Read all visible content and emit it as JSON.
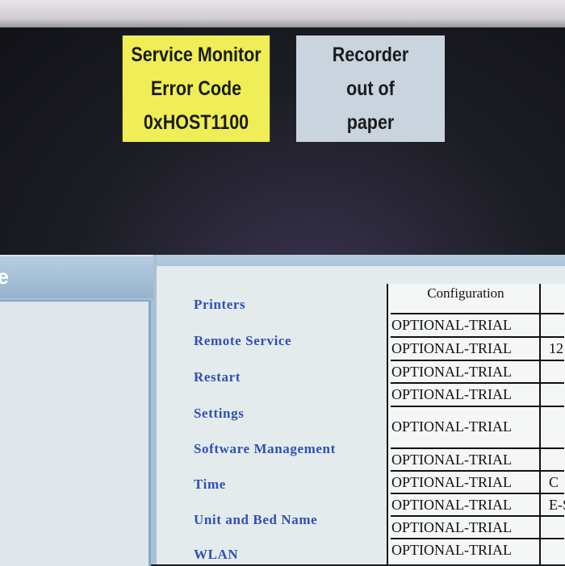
{
  "alarms": {
    "service_monitor": {
      "line1": "Service Monitor",
      "line2": "Error Code",
      "line3": "0xHOST1100",
      "color": "#efee56"
    },
    "recorder": {
      "line1": "Recorder",
      "line2": "out of",
      "line3": "paper",
      "color": "#c9d4df"
    }
  },
  "left_window": {
    "title_fragment": "ce"
  },
  "menu": {
    "items": [
      {
        "label": "Printers"
      },
      {
        "label": "Remote Service"
      },
      {
        "label": "Restart"
      },
      {
        "label": "Settings"
      },
      {
        "label": "Software Management"
      },
      {
        "label": "Time"
      },
      {
        "label": "Unit and Bed Name"
      },
      {
        "label": "WLAN"
      }
    ]
  },
  "config_table": {
    "header": "Configuration",
    "rows": [
      {
        "value": "OPTIONAL-TRIAL",
        "extra": ""
      },
      {
        "value": "OPTIONAL-TRIAL",
        "extra": "12"
      },
      {
        "value": "OPTIONAL-TRIAL",
        "extra": ""
      },
      {
        "value": "OPTIONAL-TRIAL",
        "extra": ""
      },
      {
        "value": "OPTIONAL-TRIAL",
        "extra": ""
      },
      {
        "value": "OPTIONAL-TRIAL",
        "extra": ""
      },
      {
        "value": "OPTIONAL-TRIAL",
        "extra": "C"
      },
      {
        "value": "OPTIONAL-TRIAL",
        "extra": "E-S"
      },
      {
        "value": "OPTIONAL-TRIAL",
        "extra": ""
      },
      {
        "value": "OPTIONAL-TRIAL",
        "extra": ""
      }
    ]
  }
}
